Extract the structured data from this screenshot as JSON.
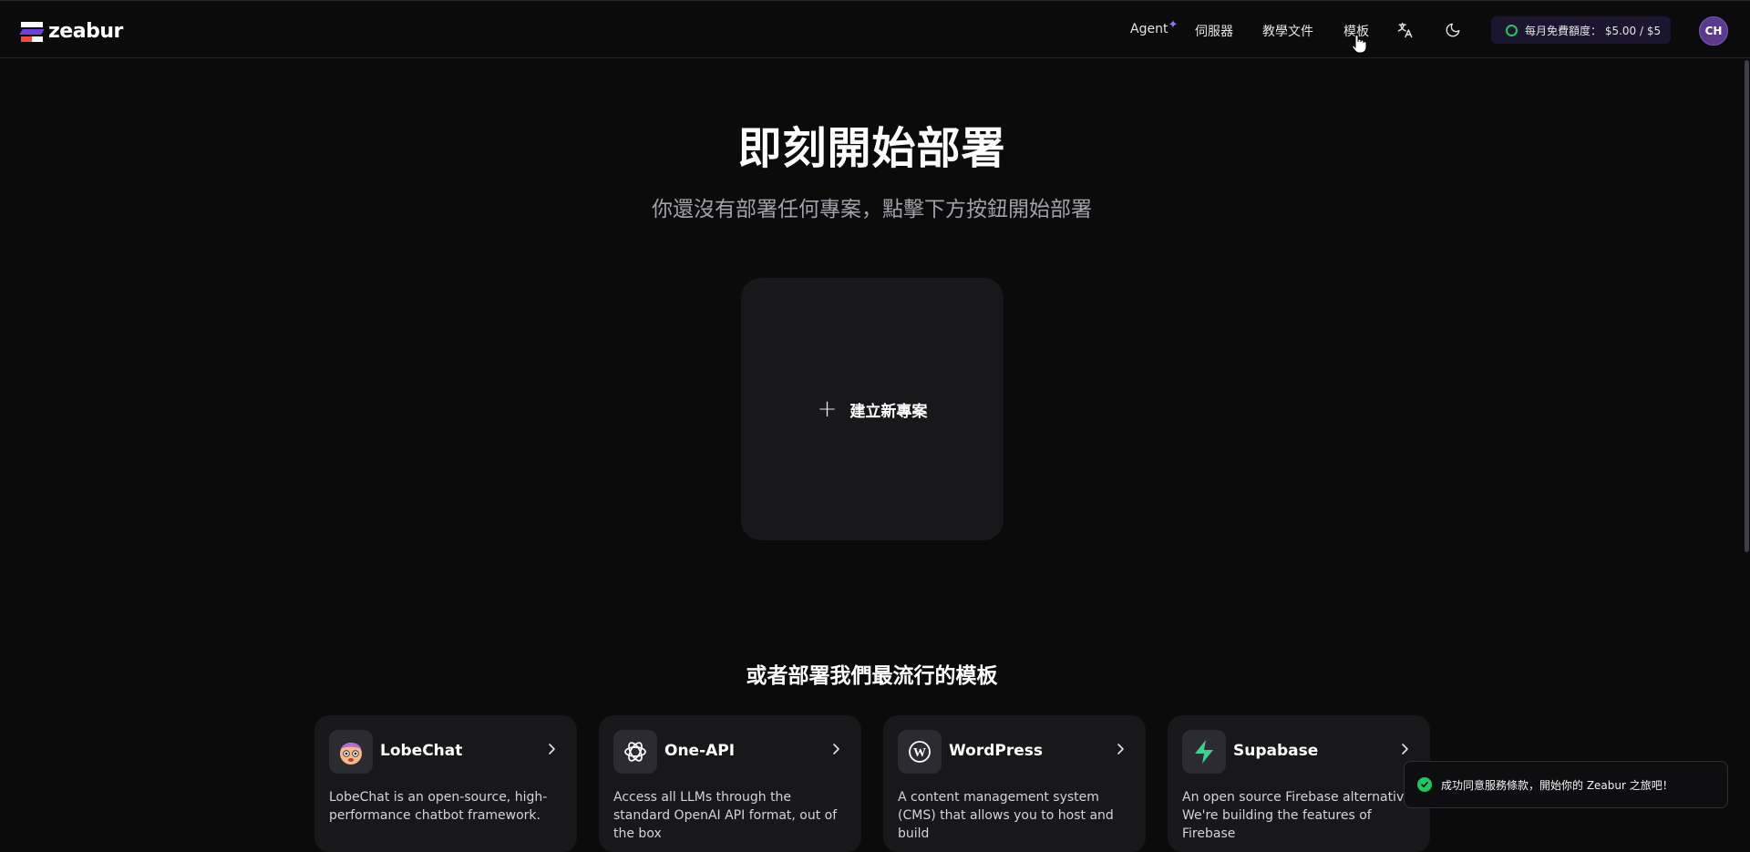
{
  "brand": {
    "name": "zeabur"
  },
  "nav": {
    "agent": "Agent",
    "servers": "伺服器",
    "docs": "教學文件",
    "templates": "模板"
  },
  "quota": {
    "text": "每月免費額度： $5.00 / $5"
  },
  "user": {
    "initials": "CH"
  },
  "hero": {
    "title": "即刻開始部署",
    "subtitle": "你還沒有部署任何專案，點擊下方按鈕開始部署",
    "new_project_label": "建立新專案"
  },
  "templates_section": {
    "title": "或者部署我們最流行的模板",
    "items": [
      {
        "name": "LobeChat",
        "icon": "lobechat-icon",
        "description": "LobeChat is an open-source, high-performance chatbot framework."
      },
      {
        "name": "One-API",
        "icon": "openai-icon",
        "description": "Access all LLMs through the standard OpenAI API format, out of the box"
      },
      {
        "name": "WordPress",
        "icon": "wordpress-icon",
        "description": "A content management system (CMS) that allows you to host and build"
      },
      {
        "name": "Supabase",
        "icon": "supabase-icon",
        "description": "An open source Firebase alternative. We're building the features of Firebase"
      }
    ]
  },
  "toast": {
    "message": "成功同意服務條款，開始你的 Zeabur 之旅吧！"
  },
  "colors": {
    "background": "#0b0b0c",
    "card": "#18181b",
    "accent_green": "#22c55e",
    "brand_purple": "#6d3fe0",
    "brand_red": "#ef4a3c"
  }
}
